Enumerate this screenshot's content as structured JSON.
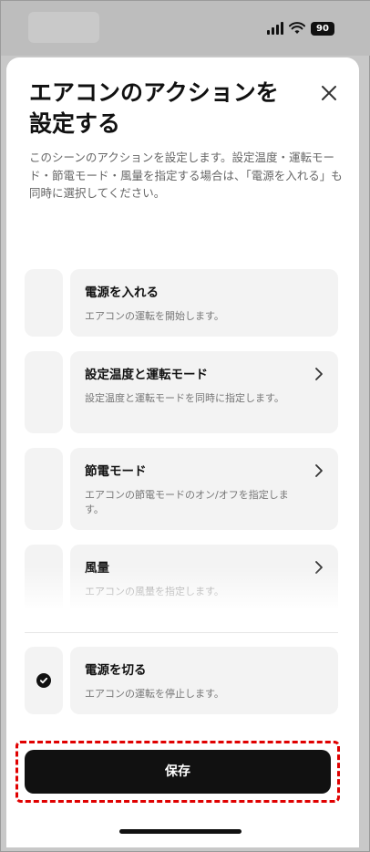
{
  "status": {
    "battery": "90"
  },
  "sheet": {
    "title": "エアコンのアクションを設定する",
    "close_icon": "close-icon",
    "description": "このシーンのアクションを設定します。設定温度・運転モード・節電モード・風量を指定する場合は、「電源を入れる」も同時に選択してください。"
  },
  "options": [
    {
      "title": "電源を入れる",
      "description": "エアコンの運転を開始します。",
      "checked": false,
      "has_chevron": false
    },
    {
      "title": "設定温度と運転モード",
      "description": "設定温度と運転モードを同時に指定します。",
      "checked": false,
      "has_chevron": true
    },
    {
      "title": "節電モード",
      "description": "エアコンの節電モードのオン/オフを指定します。",
      "checked": false,
      "has_chevron": true
    },
    {
      "title": "風量",
      "description": "エアコンの風量を指定します。",
      "checked": false,
      "has_chevron": true
    }
  ],
  "power_off": {
    "title": "電源を切る",
    "description": "エアコンの運転を停止します。",
    "checked": true
  },
  "save_label": "保存",
  "colors": {
    "highlight_border": "#e00000",
    "card_bg": "#f3f3f3",
    "primary_button": "#111111"
  }
}
